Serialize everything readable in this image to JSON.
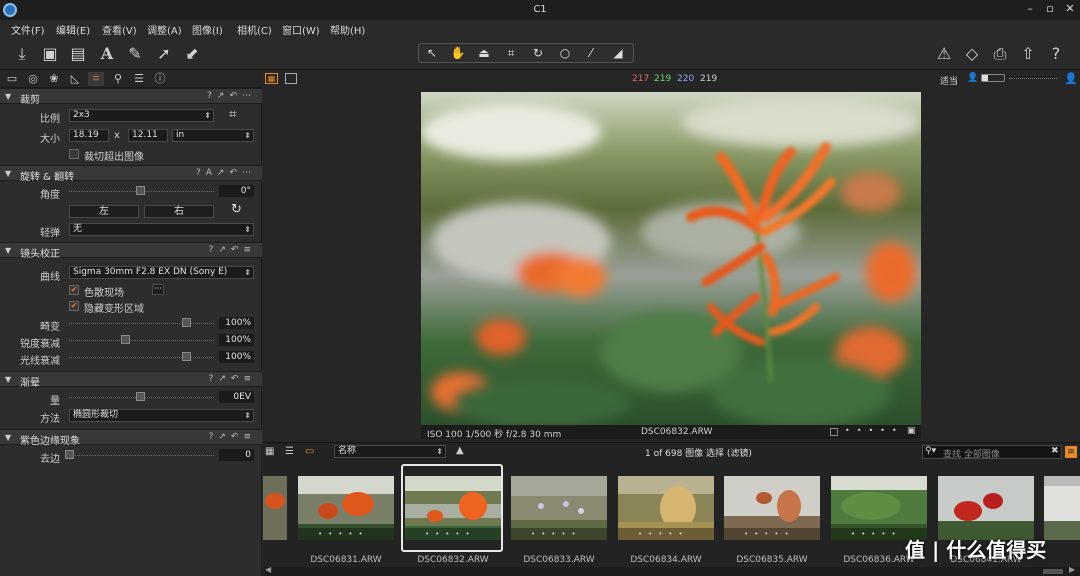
{
  "app": {
    "title": "C1"
  },
  "menu": [
    "文件(F)",
    "编辑(E)",
    "查看(V)",
    "调整(A)",
    "图像(I)",
    "相机(C)",
    "窗口(W)",
    "帮助(H)"
  ],
  "toolbar": {
    "left_icons": [
      "import-icon",
      "capture-icon",
      "export-icon",
      "text-annotation-icon",
      "brush-icon",
      "arrow-up-right-icon",
      "arrow-down-left-icon"
    ],
    "cursor_tools": [
      "select-icon",
      "hand-icon",
      "keystone-icon",
      "crop-icon",
      "rotate-icon",
      "circle-icon",
      "picker-icon",
      "eraser-icon"
    ],
    "right_icons": [
      "warning-icon",
      "proof-icon",
      "print-icon",
      "upload-icon",
      "help-icon"
    ]
  },
  "viewer_bar": {
    "r": "217",
    "g": "219",
    "b": "220",
    "l": "219",
    "zoom": "适当"
  },
  "crop": {
    "title": "裁剪",
    "ratio_label": "比例",
    "ratio_value": "2x3",
    "size_label": "大小",
    "width": "18.19",
    "x": "x",
    "height": "12.11",
    "unit": "in",
    "outside_label": "裁切超出图像"
  },
  "rotate": {
    "title": "旋转 & 翻转",
    "angle_label": "角度",
    "angle_value": "0°",
    "left": "左",
    "right": "右",
    "flip_label": "轻弹",
    "flip_value": "无"
  },
  "lens": {
    "title": "镜头校正",
    "profile_label": "曲线",
    "profile_value": "Sigma 30mm F2.8 EX DN (Sony E)",
    "more": "···",
    "cast_label": "色散现场",
    "hide_label": "隐藏变形区域",
    "distortion_label": "畸变",
    "distortion_value": "100%",
    "sharpness_label": "锐度衰减",
    "sharpness_value": "100%",
    "light_label": "光线衰减",
    "light_value": "100%"
  },
  "vignetting": {
    "title": "渐晕",
    "amount_label": "量",
    "amount_value": "0EV",
    "method_label": "方法",
    "method_value": "椭圆形裁切"
  },
  "fringe": {
    "title": "紫色边缘现象",
    "remove_label": "去边",
    "remove_value": "0"
  },
  "photo": {
    "exif": "ISO 100  1/500 秒  f/2.8  30 mm",
    "filename": "DSC06832.ARW"
  },
  "browser": {
    "sort_label": "名称",
    "count": "1 of 698 图像 选择 (滤镜)",
    "search_placeholder": "查找 全部图像"
  },
  "thumbs": [
    "DSC06831.ARW",
    "DSC06832.ARW",
    "DSC06833.ARW",
    "DSC06834.ARW",
    "DSC06835.ARW",
    "DSC06836.ARW",
    "DSC06841.ARW"
  ],
  "watermark": "值 | 什么值得买"
}
